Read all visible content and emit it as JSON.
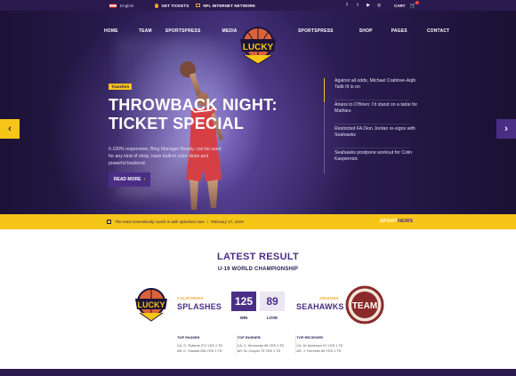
{
  "topbar": {
    "language": "English",
    "tickets": "GET TICKETS",
    "network": "NFL INTERNET NETWORK",
    "socials": [
      "f",
      "t",
      "▶",
      "◎"
    ],
    "cart": "CART"
  },
  "nav": {
    "left": [
      "HOME",
      "TEAM",
      "SPORTSPRESS",
      "MEDIA"
    ],
    "right": [
      "SPORTSPRESS",
      "SHOP",
      "PAGES",
      "CONTACT"
    ]
  },
  "logo": {
    "text": "LUCKY",
    "arc": "BASKETBALL"
  },
  "hero": {
    "tag": "Transfers",
    "headline_1": "THROWBACK NIGHT:",
    "headline_2": "TICKET SPECIAL",
    "description": "It 100% responsive, Blog Manager Ready, can be used for any kind of shop, have built-in color skins and powerful backend.",
    "button": "READ MORE",
    "news": [
      "Against all odds, Michael Crabtree-Aqib Talib III is on",
      "Arians to O'Brien: I'd stand on a table for Mathieu",
      "Restricted FA Dion Jordan re-signs with Seahawks",
      "Seahawks postpone workout for Colin Kaepernick"
    ]
  },
  "ticker": {
    "text": "The most insensitively coach is with Splashes now",
    "date": "February 17, 2019",
    "brand_1": "SPORT",
    "brand_2": "NEWS"
  },
  "results": {
    "title": "LATEST RESULT",
    "subtitle": "U-19 WORLD CHAMPIONSHIP",
    "home": {
      "city": "CALIFORNIA",
      "name": "SPLASHES",
      "score": "125",
      "label": "WIN"
    },
    "away": {
      "city": "ARIZONA",
      "name": "SEAHAWKS",
      "score": "89",
      "label": "LOSE",
      "logo_text": "TEAM"
    },
    "leaders": [
      {
        "title": "TOP PASSER",
        "rows": [
          "CA. O. Roberts 271 YDS 1 TD",
          "AR. K. Howard 256 YDS 1 TD"
        ]
      },
      {
        "title": "TOP RUSHER",
        "rows": [
          "CA. C. Kinnaman 98 YDS 1 TD",
          "AR. W. Cooper 70 YDS 1 TD"
        ]
      },
      {
        "title": "TOP RECEIVER",
        "rows": [
          "CA. M. Anderson 91 YDS 1 TD",
          "AR. J. Forrester 84 YDS 1 TD"
        ]
      }
    ]
  },
  "colors": {
    "purple": "#4a2e86",
    "dark": "#2a1a4e",
    "yellow": "#f5c518"
  }
}
